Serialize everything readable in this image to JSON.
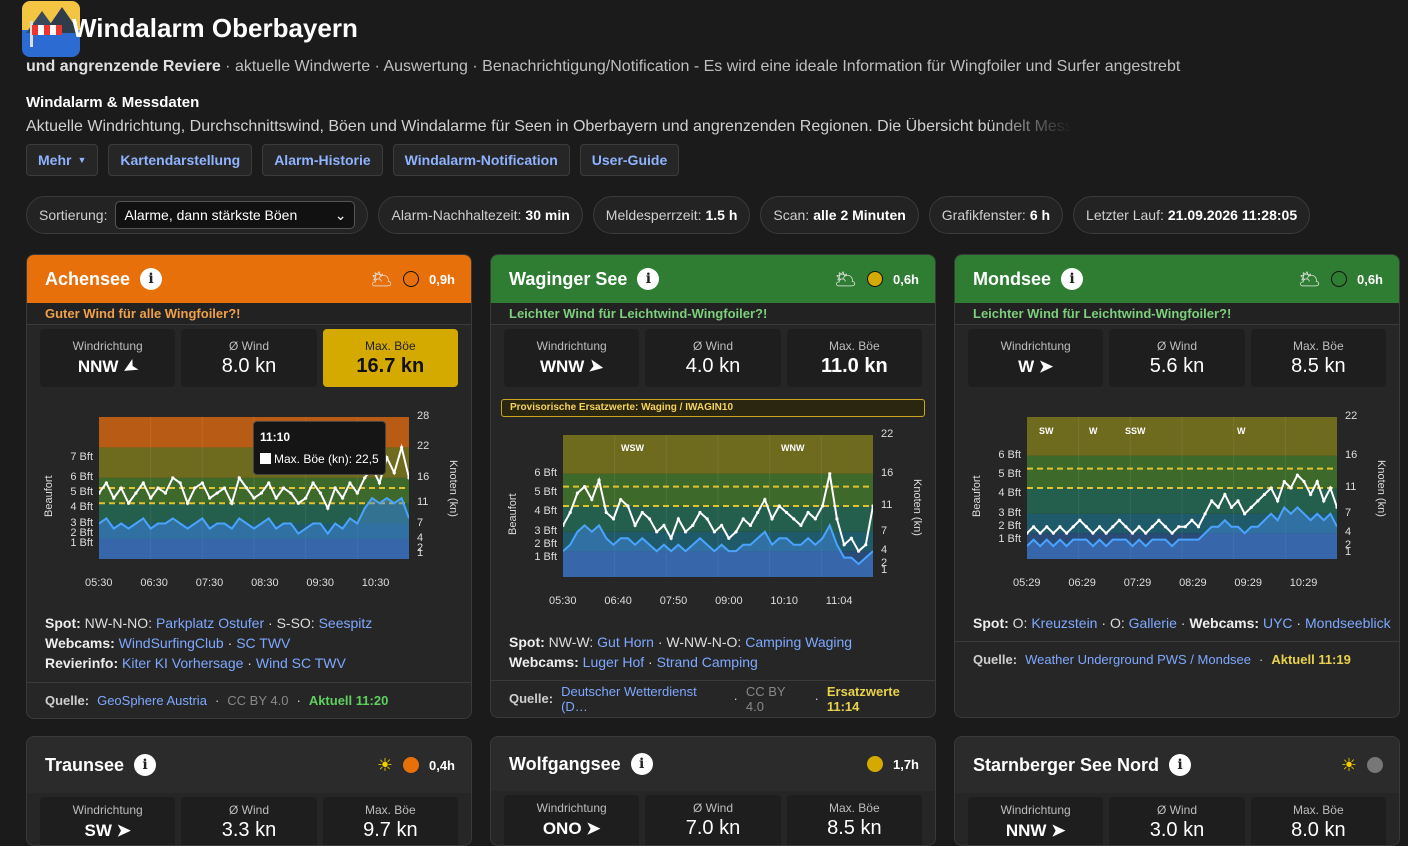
{
  "app": {
    "title": "Windalarm Oberbayern",
    "subtitle_bold": "und angrenzende Reviere",
    "subtitle": " · aktuelle Windwerte · Auswertung · Benachrichtigung/Notification - Es wird eine ideale Information für Wingfoiler und Surfer angestrebt",
    "section_title": "Windalarm & Messdaten",
    "section_desc": "Aktuelle Windrichtung, Durchschnittswind, Böen und Windalarme für Seen in Oberbayern und angrenzenden Regionen. Die Übersicht bündelt Messdaten"
  },
  "nav": {
    "more": "Mehr",
    "map": "Kartendarstellung",
    "history": "Alarm-Historie",
    "notification": "Windalarm-Notification",
    "guide": "User-Guide"
  },
  "toolbar": {
    "sort_label": "Sortierung:",
    "sort_value": "Alarme, dann stärkste Böen",
    "hold_label": "Alarm-Nachhaltezeit:",
    "hold_value": "30 min",
    "block_label": "Meldesperrzeit:",
    "block_value": "1.5 h",
    "scan_label": "Scan:",
    "scan_value": "alle 2 Minuten",
    "window_label": "Grafikfenster:",
    "window_value": "6 h",
    "last_label": "Letzter Lauf:",
    "last_value": "21.09.2026 11:28:05"
  },
  "labels": {
    "dir": "Windrichtung",
    "avg": "Ø Wind",
    "gust": "Max. Böe",
    "beaufort": "Beaufort",
    "knots": "Knoten (kn)",
    "info": "i"
  },
  "cards": [
    {
      "name": "Achensee",
      "age": "0,9h",
      "header_color": "#e8700a",
      "status_color": "#e8700a",
      "message": "Guter Wind für alle Wingfoiler?!",
      "message_color": "#f0a04a",
      "dir": "NNW",
      "avg": "8.0 kn",
      "gust": "16.7 kn",
      "spot_label": "Spot:",
      "spot1": "NW-N-NO:",
      "spot1_link": "Parkplatz Ostufer",
      "spot2": "S-SO:",
      "spot2_link": "Seespitz",
      "webcam_label": "Webcams:",
      "webcam1": "WindSurfingClub",
      "webcam2": "SC TWV",
      "revier_label": "Revierinfo:",
      "revier1": "Kiter KI Vorhersage",
      "revier2": "Wind SC TWV",
      "source_label": "Quelle:",
      "source": "GeoSphere Austria",
      "license": "CC BY 4.0",
      "updated": "Aktuell 11:20",
      "tooltip_time": "11:10",
      "tooltip_text": "Max. Böe (kn): 22,5"
    },
    {
      "name": "Waginger See",
      "age": "0,6h",
      "header_color": "#2e7d32",
      "status_color": "#d4aa00",
      "message": "Leichter Wind für Leichtwind-Wingfoiler?!",
      "message_color": "#7ccf7c",
      "dir": "WNW",
      "avg": "4.0 kn",
      "gust": "11.0 kn",
      "provisional": "Provisorische Ersatzwerte: Waging / IWAGIN10",
      "spot_label": "Spot:",
      "spot1": "NW-W:",
      "spot1_link": "Gut Horn",
      "spot2": "W-NW-N-O:",
      "spot2_link": "Camping Waging",
      "webcam_label": "Webcams:",
      "webcam1": "Luger Hof",
      "webcam2": "Strand Camping",
      "source_label": "Quelle:",
      "source": "Deutscher Wetterdienst (D…",
      "license": "CC BY 4.0",
      "updated": "Ersatzwerte 11:14",
      "marker1": "WSW",
      "marker2": "WNW"
    },
    {
      "name": "Mondsee",
      "age": "0,6h",
      "header_color": "#2e7d32",
      "status_color": "#2e7d32",
      "message": "Leichter Wind für Leichtwind-Wingfoiler?!",
      "message_color": "#7ccf7c",
      "dir": "W",
      "avg": "5.6 kn",
      "gust": "8.5 kn",
      "spot_label": "Spot:",
      "spot1": "O:",
      "spot1_link": "Kreuzstein",
      "spot2": "O:",
      "spot2_link": "Gallerie",
      "webcam_label": "Webcams:",
      "webcam1": "UYC",
      "webcam2": "Mondseeblick",
      "source_label": "Quelle:",
      "source": "Weather Underground PWS / Mondsee",
      "updated": "Aktuell 11:19",
      "marker1": "SW",
      "marker2": "W",
      "marker3": "SSW",
      "marker4": "W"
    },
    {
      "name": "Traunsee",
      "age": "0,4h",
      "status_color": "#e8700a",
      "dir": "SW",
      "avg": "3.3 kn",
      "gust": "9.7 kn"
    },
    {
      "name": "Wolfgangsee",
      "age": "1,7h",
      "status_color": "#d4aa00",
      "dir": "ONO",
      "avg": "7.0 kn",
      "gust": "8.5 kn"
    },
    {
      "name": "Starnberger See Nord",
      "age": "",
      "status_color": "#777777",
      "dir": "NNW",
      "avg": "3.0 kn",
      "gust": "8.0 kn"
    }
  ],
  "chart_data": [
    {
      "type": "line",
      "title": "",
      "x": [
        "05:30",
        "06:30",
        "07:30",
        "08:30",
        "09:30",
        "10:30"
      ],
      "ylabel": "Beaufort",
      "y2label": "Knoten (kn)",
      "yticks": [
        "1 Bft",
        "2 Bft",
        "3 Bft",
        "4 Bft",
        "5 Bft",
        "6 Bft",
        "7 Bft"
      ],
      "y2ticks": [
        1,
        2,
        4,
        7,
        11,
        16,
        22,
        28
      ],
      "ylim": [
        0,
        28
      ],
      "series": [
        {
          "name": "Max. Böe (kn)",
          "values": [
            13,
            15,
            12,
            14,
            11,
            13,
            15,
            12,
            14,
            13,
            16,
            15,
            11,
            14,
            15,
            12,
            13,
            14,
            11,
            16,
            14,
            12,
            13,
            15,
            12,
            14,
            13,
            11,
            12,
            15,
            13,
            10,
            14,
            12,
            15,
            13,
            16,
            18,
            15,
            20,
            17,
            22,
            16
          ]
        },
        {
          "name": "",
          "values": [
            7,
            8,
            6,
            7,
            6,
            7,
            8,
            6,
            7,
            7,
            8,
            7,
            6,
            7,
            8,
            6,
            7,
            7,
            6,
            8,
            7,
            6,
            7,
            8,
            6,
            7,
            7,
            5,
            6,
            7,
            7,
            5,
            7,
            6,
            8,
            7,
            10,
            12,
            11,
            12,
            11,
            12,
            8
          ]
        }
      ]
    },
    {
      "type": "line",
      "title": "",
      "x": [
        "05:30",
        "06:40",
        "07:50",
        "09:00",
        "10:10",
        "11:04"
      ],
      "ylabel": "Beaufort",
      "y2label": "Knoten (kn)",
      "yticks": [
        "1 Bft",
        "2 Bft",
        "3 Bft",
        "4 Bft",
        "5 Bft",
        "6 Bft"
      ],
      "y2ticks": [
        1,
        2,
        4,
        7,
        11,
        16,
        22
      ],
      "ylim": [
        0,
        22
      ],
      "series": [
        {
          "name": "",
          "values": [
            8,
            10,
            13,
            14,
            12,
            15,
            10,
            9,
            12,
            11,
            8,
            10,
            9,
            7,
            8,
            6,
            9,
            7,
            8,
            10,
            9,
            7,
            8,
            6,
            7,
            9,
            8,
            10,
            12,
            9,
            11,
            10,
            9,
            8,
            10,
            9,
            11,
            16,
            9,
            5,
            6,
            4,
            5,
            11
          ]
        },
        {
          "name": "",
          "values": [
            4,
            5,
            7,
            8,
            7,
            8,
            6,
            5,
            6,
            6,
            5,
            6,
            5,
            4,
            5,
            4,
            5,
            4,
            5,
            6,
            5,
            4,
            5,
            4,
            4,
            5,
            5,
            6,
            7,
            5,
            6,
            6,
            5,
            5,
            6,
            5,
            6,
            8,
            5,
            3,
            3,
            2,
            3,
            4
          ]
        }
      ]
    },
    {
      "type": "line",
      "title": "",
      "x": [
        "05:29",
        "06:29",
        "07:29",
        "08:29",
        "09:29",
        "10:29"
      ],
      "ylabel": "Beaufort",
      "y2label": "Knoten (kn)",
      "yticks": [
        "1 Bft",
        "2 Bft",
        "3 Bft",
        "4 Bft",
        "5 Bft",
        "6 Bft"
      ],
      "y2ticks": [
        1,
        2,
        4,
        7,
        11,
        16,
        22
      ],
      "ylim": [
        0,
        22
      ],
      "series": [
        {
          "name": "",
          "values": [
            4,
            5,
            4,
            5,
            4,
            5,
            4,
            5,
            6,
            5,
            4,
            5,
            4,
            5,
            6,
            5,
            4,
            5,
            4,
            5,
            6,
            5,
            4,
            5,
            5,
            6,
            5,
            7,
            9,
            8,
            10,
            8,
            9,
            7,
            8,
            9,
            10,
            11,
            9,
            12,
            11,
            13,
            12,
            10,
            12,
            9,
            11,
            8
          ]
        },
        {
          "name": "",
          "values": [
            2,
            3,
            2,
            3,
            2,
            3,
            2,
            3,
            3,
            3,
            2,
            3,
            2,
            3,
            3,
            3,
            2,
            3,
            2,
            3,
            3,
            3,
            2,
            3,
            3,
            3,
            3,
            4,
            5,
            5,
            6,
            5,
            5,
            4,
            5,
            5,
            6,
            7,
            6,
            8,
            7,
            8,
            7,
            6,
            7,
            6,
            7,
            5
          ]
        }
      ]
    }
  ]
}
